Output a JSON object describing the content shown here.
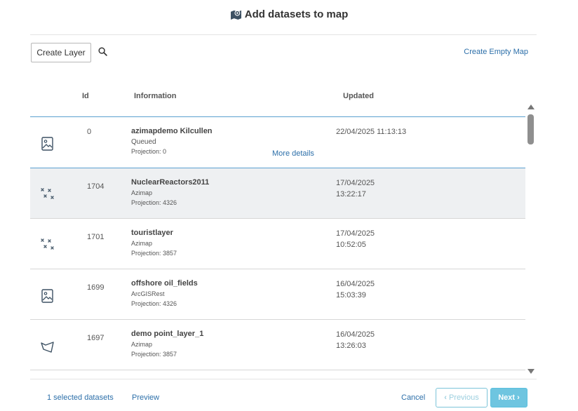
{
  "dialog": {
    "title": "Add datasets to map"
  },
  "toolbar": {
    "create_layer_label": "Create Layer",
    "create_empty_map_label": "Create Empty Map"
  },
  "table": {
    "headers": {
      "id": "Id",
      "information": "Information",
      "updated": "Updated"
    },
    "more_details_label": "More details",
    "rows": [
      {
        "icon": "image-icon",
        "id": "0",
        "name": "azimapdemo Kilcullen",
        "source": "Queued",
        "projection": "Projection: 0",
        "updated_line1": "22/04/2025 11:13:13",
        "updated_line2": "",
        "selected": false
      },
      {
        "icon": "points-icon",
        "id": "1704",
        "name": "NuclearReactors2011",
        "source": "Azimap",
        "projection": "Projection: 4326",
        "updated_line1": "17/04/2025",
        "updated_line2": "13:22:17",
        "selected": true
      },
      {
        "icon": "points-icon",
        "id": "1701",
        "name": "touristlayer",
        "source": "Azimap",
        "projection": "Projection: 3857",
        "updated_line1": "17/04/2025",
        "updated_line2": "10:52:05",
        "selected": false
      },
      {
        "icon": "image-icon",
        "id": "1699",
        "name": "offshore oil_fields",
        "source": "ArcGISRest",
        "projection": "Projection: 4326",
        "updated_line1": "16/04/2025",
        "updated_line2": "15:03:39",
        "selected": false
      },
      {
        "icon": "polygon-icon",
        "id": "1697",
        "name": "demo point_layer_1",
        "source": "Azimap",
        "projection": "Projection: 3857",
        "updated_line1": "16/04/2025",
        "updated_line2": "13:26:03",
        "selected": false
      }
    ]
  },
  "footer": {
    "selected_count_label": "1 selected datasets",
    "preview_label": "Preview",
    "cancel_label": "Cancel",
    "previous_label": "Previous",
    "next_label": "Next"
  },
  "colors": {
    "link": "#2c6fa9",
    "selected_row": "#eef0f2",
    "accent": "#5bc0de",
    "icon": "#3d5163"
  }
}
